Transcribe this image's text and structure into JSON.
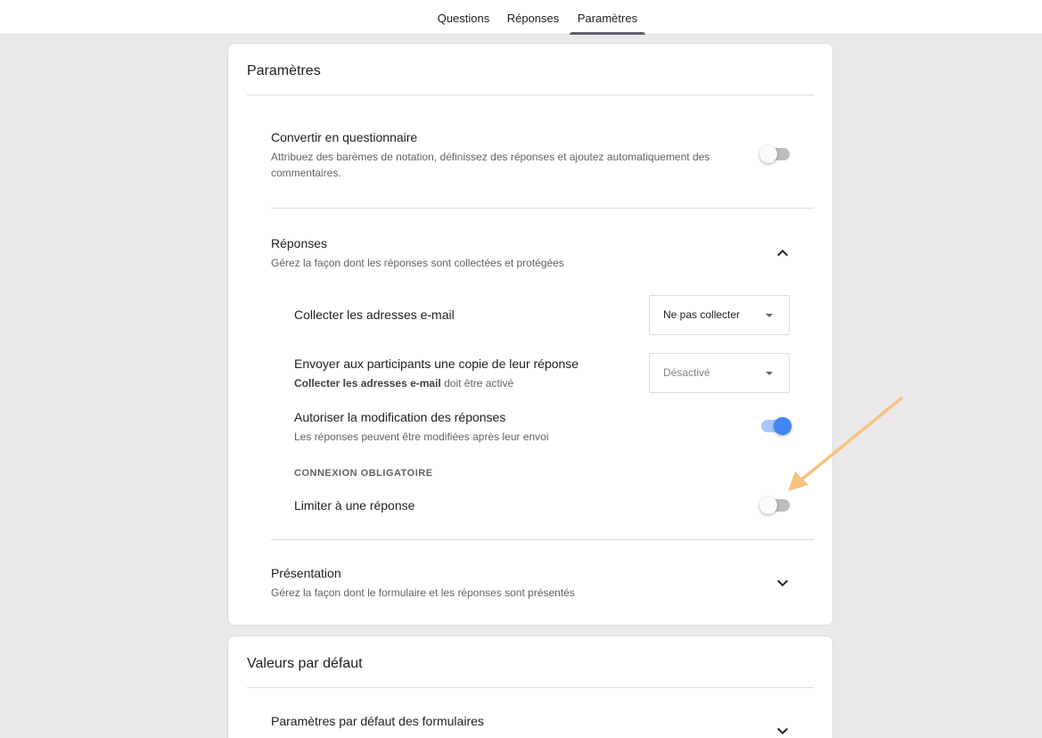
{
  "tabs": [
    {
      "label": "Questions"
    },
    {
      "label": "Réponses"
    },
    {
      "label": "Paramètres",
      "active": true
    }
  ],
  "settings_card": {
    "title": "Paramètres",
    "quiz": {
      "title": "Convertir en questionnaire",
      "desc": "Attribuez des barèmes de notation, définissez des réponses et ajoutez automatiquement des commentaires.",
      "enabled": false
    },
    "responses": {
      "title": "Réponses",
      "desc": "Gérez la façon dont les réponses sont collectées et protégées",
      "expanded": true,
      "collect_email": {
        "label": "Collecter les adresses e-mail",
        "selected": "Ne pas collecter"
      },
      "send_copy": {
        "label": "Envoyer aux participants une copie de leur réponse",
        "desc_bold": "Collecter les adresses e-mail",
        "desc_rest": " doit être activé",
        "selected": "Désactivé"
      },
      "allow_edit": {
        "label": "Autoriser la modification des réponses",
        "desc": "Les réponses peuvent être modifiées après leur envoi",
        "enabled": true
      },
      "login_required_header": "CONNEXION OBLIGATOIRE",
      "limit_one": {
        "label": "Limiter à une réponse",
        "enabled": false
      }
    },
    "presentation": {
      "title": "Présentation",
      "desc": "Gérez la façon dont le formulaire et les réponses sont présentés",
      "expanded": false
    }
  },
  "defaults_card": {
    "title": "Valeurs par défaut",
    "form_defaults": {
      "title": "Paramètres par défaut des formulaires"
    }
  },
  "colors": {
    "annotation_arrow": "#f9c27f",
    "toggle_on": "#4285f4"
  }
}
